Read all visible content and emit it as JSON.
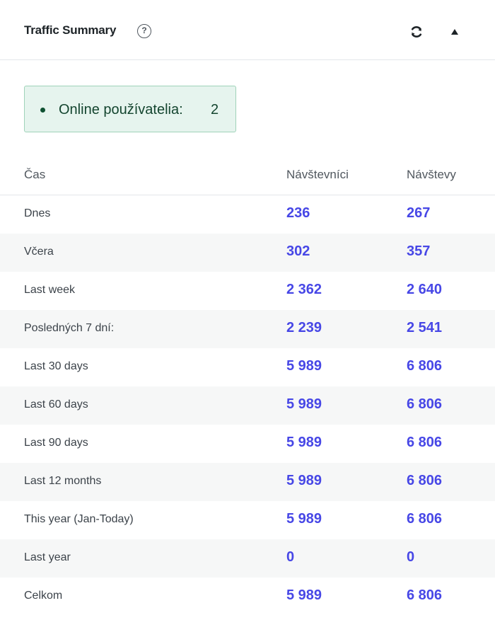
{
  "header": {
    "title": "Traffic Summary",
    "help_icon": "question-circle-icon",
    "help_glyph": "?",
    "refresh_icon": "refresh-icon",
    "collapse_icon": "caret-up-icon"
  },
  "online": {
    "label": "Online používatelia:",
    "count": "2",
    "color": "#e6f4ee"
  },
  "table": {
    "columns": [
      "Čas",
      "Návštevníci",
      "Návštevy"
    ],
    "rows": [
      {
        "label": "Dnes",
        "visitors": "236",
        "visits": "267"
      },
      {
        "label": "Včera",
        "visitors": "302",
        "visits": "357"
      },
      {
        "label": "Last week",
        "visitors": "2 362",
        "visits": "2 640"
      },
      {
        "label": "Posledných 7 dní:",
        "visitors": "2 239",
        "visits": "2 541"
      },
      {
        "label": "Last 30 days",
        "visitors": "5 989",
        "visits": "6 806"
      },
      {
        "label": "Last 60 days",
        "visitors": "5 989",
        "visits": "6 806"
      },
      {
        "label": "Last 90 days",
        "visitors": "5 989",
        "visits": "6 806"
      },
      {
        "label": "Last 12 months",
        "visitors": "5 989",
        "visits": "6 806"
      },
      {
        "label": "This year (Jan-Today)",
        "visitors": "5 989",
        "visits": "6 806"
      },
      {
        "label": "Last year",
        "visitors": "0",
        "visits": "0"
      },
      {
        "label": "Celkom",
        "visitors": "5 989",
        "visits": "6 806"
      }
    ]
  },
  "colors": {
    "accent_number": "#4747e6",
    "row_shade": "#f6f7f7"
  }
}
